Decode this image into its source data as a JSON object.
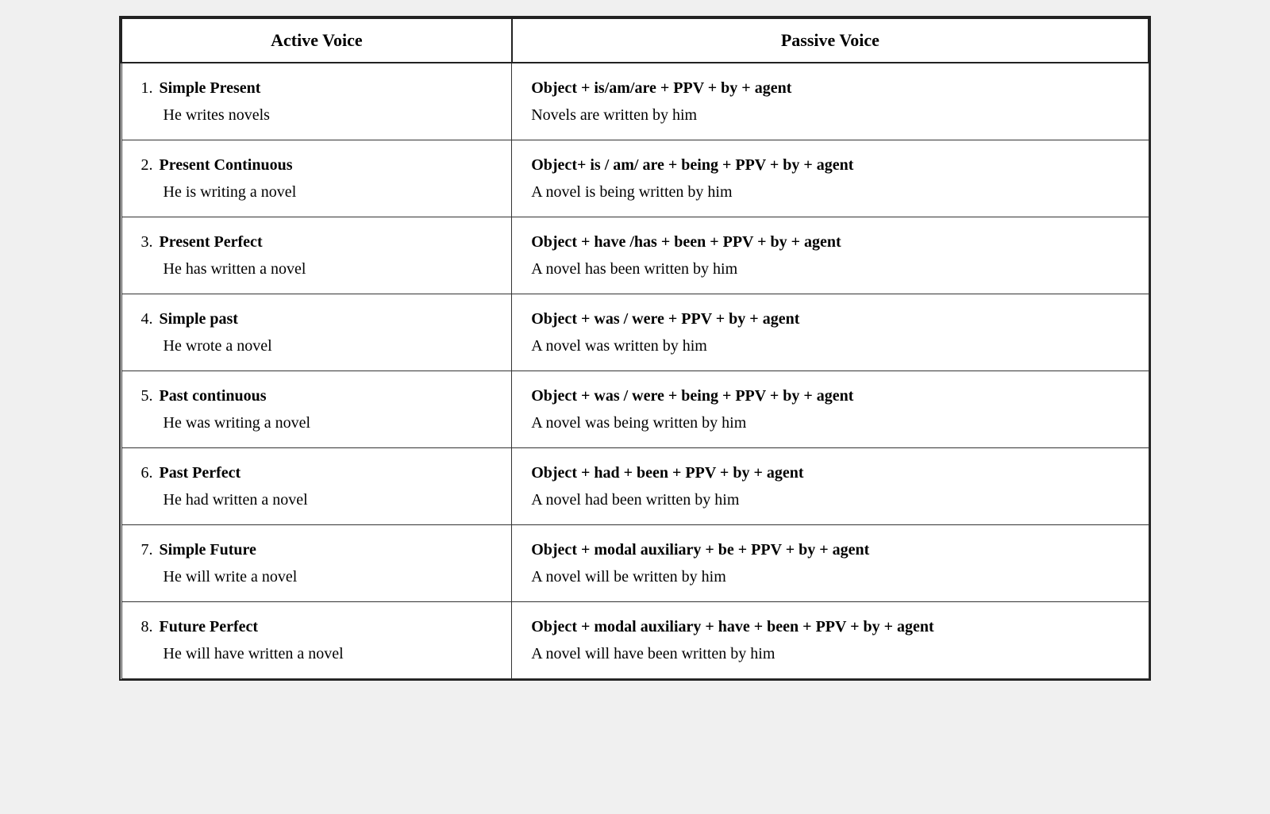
{
  "headers": {
    "active": "Active Voice",
    "passive": "Passive Voice"
  },
  "rows": [
    {
      "number": "1.",
      "tense": "Simple Present",
      "active_example": "He writes novels",
      "formula": "Object + is/am/are + PPV + by + agent",
      "passive_example": "Novels are written by him"
    },
    {
      "number": "2.",
      "tense": "Present Continuous",
      "active_example": "He is writing a novel",
      "formula": "Object+ is / am/ are + being + PPV + by + agent",
      "passive_example": "A novel is being written by him"
    },
    {
      "number": "3.",
      "tense": "Present Perfect",
      "active_example": "He has written a novel",
      "formula": "Object + have /has + been + PPV + by + agent",
      "passive_example": "A novel has been written by him"
    },
    {
      "number": "4.",
      "tense": "Simple past",
      "active_example": "He wrote a novel",
      "formula": "Object + was / were + PPV + by + agent",
      "passive_example": "A novel was written by him"
    },
    {
      "number": "5.",
      "tense": "Past continuous",
      "active_example": "He was writing a novel",
      "formula": "Object + was / were + being + PPV + by + agent",
      "passive_example": "A novel was  being written by him"
    },
    {
      "number": "6.",
      "tense": "Past Perfect",
      "active_example": "He had written a novel",
      "formula": "Object + had + been + PPV + by + agent",
      "passive_example": "A novel had been written by him"
    },
    {
      "number": "7.",
      "tense": "Simple Future",
      "active_example": "He will write a novel",
      "formula": "Object + modal auxiliary + be + PPV + by + agent",
      "passive_example": "A novel will be written by him"
    },
    {
      "number": "8.",
      "tense": "Future Perfect",
      "active_example": "He will have written a novel",
      "formula": "Object + modal auxiliary +  have + been + PPV + by + agent",
      "passive_example": "A novel will have been written by him"
    }
  ]
}
